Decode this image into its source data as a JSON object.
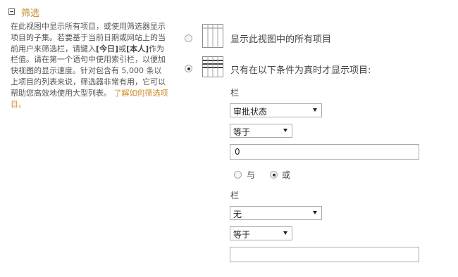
{
  "section": {
    "title": "筛选",
    "description": {
      "p1": "在此视图中显示所有项目，或使用筛选器显示项目的子集。若要基于当前日期或网站上的当前用户来筛选栏，请键入",
      "today": "[今日]",
      "p2": "或",
      "me": "[本人]",
      "p3": "作为栏值。请在第一个语句中使用索引栏，以便加快视图的显示速度。针对包含有 5,000 条以上项目的列表来说，筛选器非常有用，它可以帮助您高效地使用大型列表。",
      "link": "了解如何筛选项目。"
    }
  },
  "options": {
    "show_all": {
      "label": "显示此视图中的所有项目",
      "icon": "table-grid-icon",
      "selected": false
    },
    "show_filtered": {
      "label": "只有在以下条件为真时才显示项目:",
      "icon": "table-filter-icon",
      "selected": true
    }
  },
  "filter1": {
    "column_label": "栏",
    "column_value": "审批状态",
    "operator_value": "等于",
    "value": "0"
  },
  "logic": {
    "and_label": "与",
    "or_label": "或",
    "selected": "or"
  },
  "filter2": {
    "column_label": "栏",
    "column_value": "无",
    "operator_value": "等于",
    "value": ""
  },
  "colors": {
    "accent": "#c28b2b",
    "link": "#d08c2a",
    "border": "#ababab"
  }
}
